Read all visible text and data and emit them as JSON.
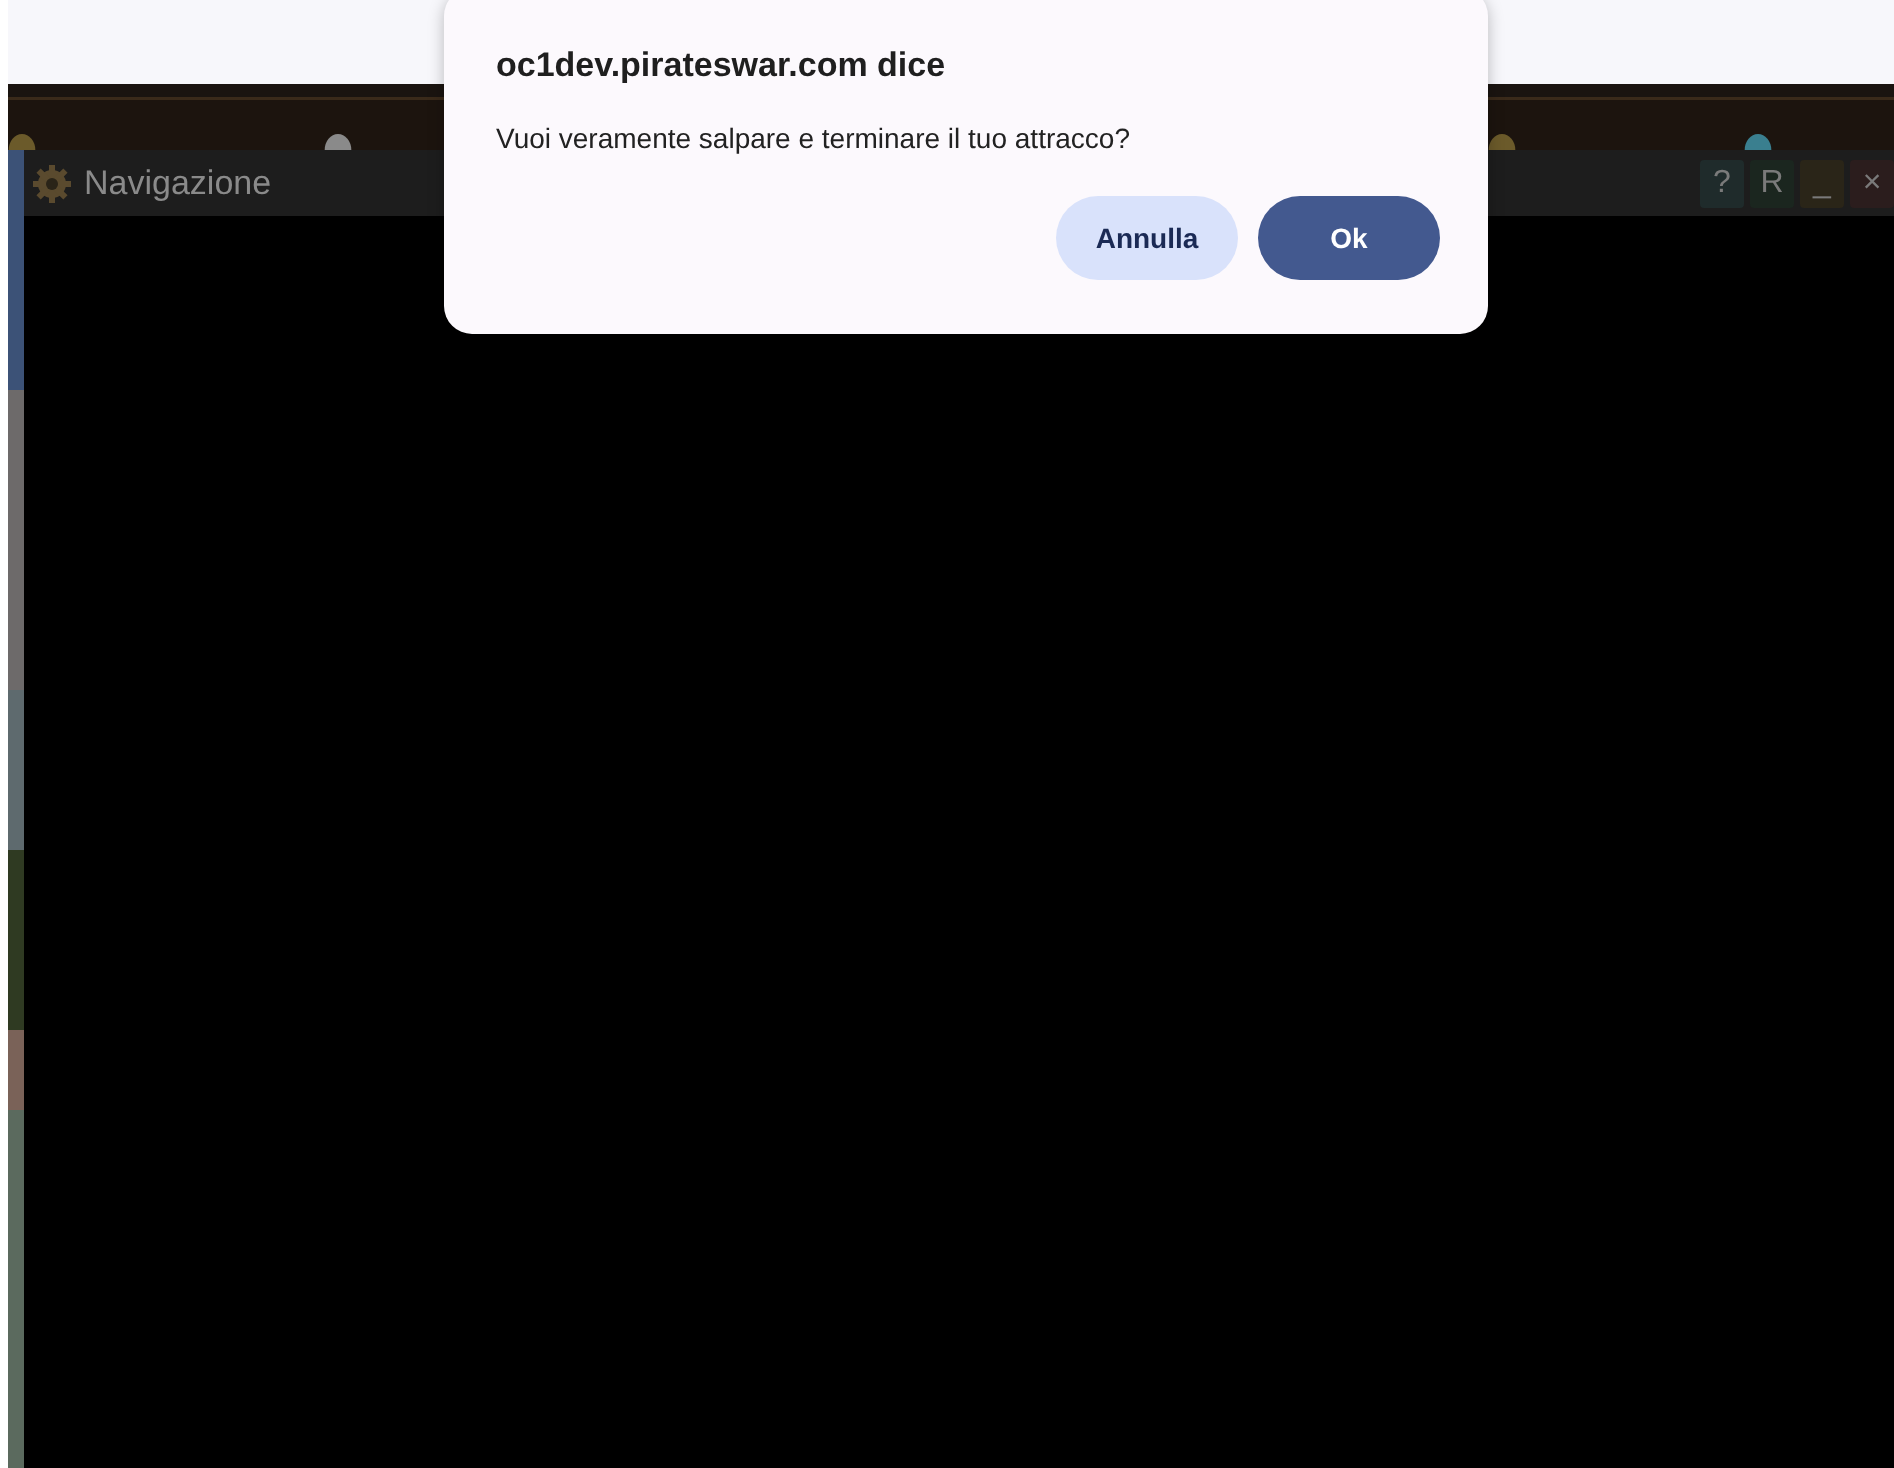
{
  "dialog": {
    "title": "oc1dev.pirateswar.com dice",
    "message": "Vuoi veramente salpare e terminare il tuo attracco?",
    "buttons": [
      {
        "label": "Annulla",
        "kind": "secondary"
      },
      {
        "label": "Ok",
        "kind": "primary"
      }
    ]
  },
  "window": {
    "title": "Navigazione",
    "buttons": [
      {
        "label": "?",
        "color": "#1f2b2b"
      },
      {
        "label": "R",
        "color": "#1b261f"
      },
      {
        "label": "_",
        "color": "#2a2518"
      },
      {
        "label": "×",
        "color": "#2b1d1d"
      }
    ]
  }
}
